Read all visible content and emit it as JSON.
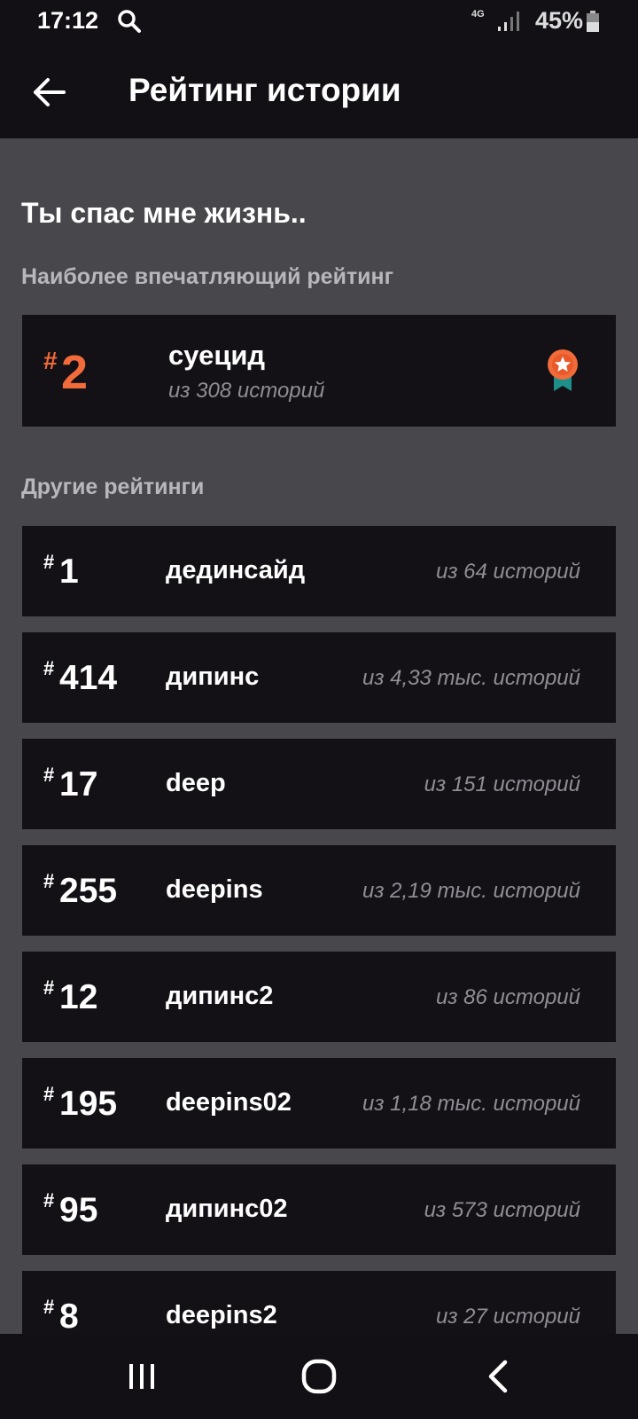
{
  "status": {
    "time": "17:12",
    "network": "4G",
    "battery": "45%"
  },
  "header": {
    "title": "Рейтинг истории"
  },
  "story": {
    "title": "Ты спас мне жизнь.."
  },
  "best": {
    "label": "Наиболее впечатляющий рейтинг",
    "hash": "#",
    "rank": "2",
    "tag": "суецид",
    "count": "из 308 историй",
    "accent_color": "#f26b3a"
  },
  "others": {
    "label": "Другие рейтинги",
    "items": [
      {
        "rank": "1",
        "tag": "дединсайд",
        "count": "из 64 историй"
      },
      {
        "rank": "414",
        "tag": "дипинс",
        "count": "из 4,33 тыс. историй"
      },
      {
        "rank": "17",
        "tag": "deep",
        "count": "из 151 историй"
      },
      {
        "rank": "255",
        "tag": "deepins",
        "count": "из 2,19 тыс. историй"
      },
      {
        "rank": "12",
        "tag": "дипинс2",
        "count": "из 86 историй"
      },
      {
        "rank": "195",
        "tag": "deepins02",
        "count": "из 1,18 тыс. историй"
      },
      {
        "rank": "95",
        "tag": "дипинс02",
        "count": "из 573 историй"
      },
      {
        "rank": "8",
        "tag": "deepins2",
        "count": "из 27 историй"
      }
    ]
  },
  "icons": {
    "back": "arrow-left-icon",
    "medal": "medal-icon",
    "nav_recents": "recents-icon",
    "nav_home": "home-icon",
    "nav_back": "back-chevron-icon"
  }
}
